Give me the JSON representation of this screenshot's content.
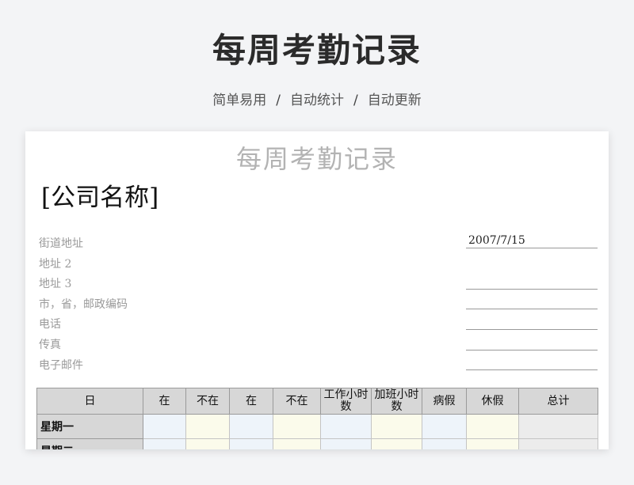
{
  "header": {
    "title": "每周考勤记录",
    "features": [
      "简单易用",
      "自动统计",
      "自动更新"
    ],
    "separator": "/"
  },
  "sheet": {
    "title": "每周考勤记录",
    "company": "[公司名称]",
    "address_lines": [
      "街道地址",
      "地址 2",
      "地址 3",
      "市，省，邮政编码",
      "电话",
      "传真",
      "电子邮件"
    ],
    "date": "2007/7/15"
  },
  "table": {
    "headers": [
      "日",
      "在",
      "不在",
      "在",
      "不在",
      "工作小时数",
      "加班小时数",
      "病假",
      "休假",
      "总计"
    ],
    "rows": [
      "星期一",
      "星期二"
    ]
  },
  "colors": {
    "header_bg": "#d7d7d7",
    "cell_blue": "#eef4fa",
    "cell_yellow": "#fbfbeb",
    "cell_gray": "#ececec"
  }
}
